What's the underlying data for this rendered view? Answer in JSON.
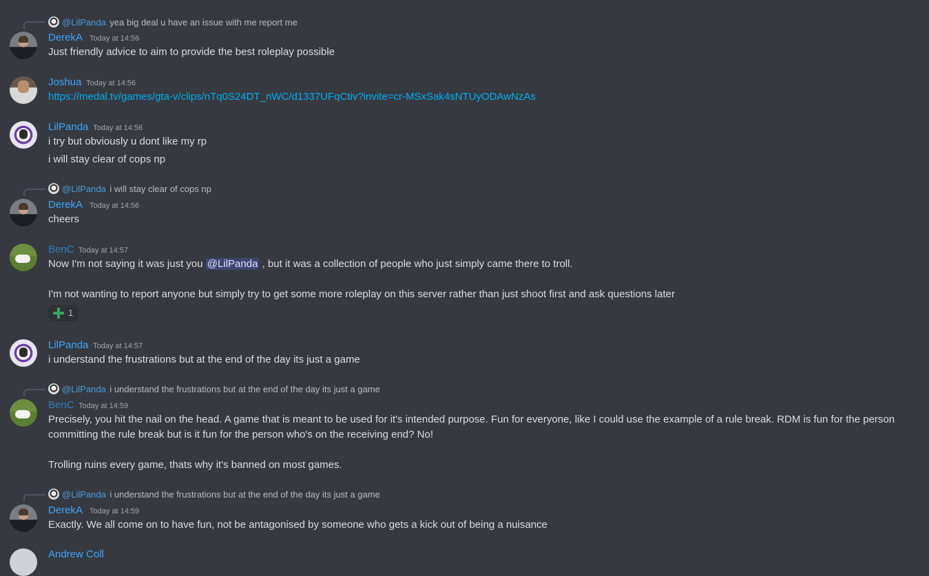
{
  "colors": {
    "background": "#36393f",
    "derek": "#3ea6ff",
    "joshua": "#3ea6ff",
    "lilpanda": "#3ea6ff",
    "benc": "#2f7fc1",
    "andy": "#3ea6ff",
    "link": "#00aff4",
    "reaction_icon": "#3ba55c"
  },
  "messages": [
    {
      "reply": {
        "name": "@LilPanda",
        "text": "yea big deal u have an issue with me report me"
      },
      "author": "DerekA",
      "time": "Today at 14:56",
      "lines": [
        "Just friendly advice to aim to provide the best roleplay possible"
      ]
    },
    {
      "author": "Joshua",
      "time": "Today at 14:56",
      "lines": [
        "https://medal.tv/games/gta-v/clips/nTq0S24DT_nWC/d1337UFqCtiv?invite=cr-MSxSak4sNTUyODAwNzAs"
      ]
    },
    {
      "author": "LilPanda",
      "time": "Today at 14:56",
      "lines": [
        "i try but obviously u dont like my rp",
        "i will stay clear of cops np"
      ]
    },
    {
      "reply": {
        "name": "@LilPanda",
        "text": "i will stay clear of cops np"
      },
      "author": "DerekA",
      "time": "Today at 14:56",
      "lines": [
        "cheers"
      ]
    },
    {
      "author": "BenC",
      "time": "Today at 14:57",
      "line1_before": "Now I'm not saying it was just you",
      "mention": "@LilPanda",
      "line1_after": ", but it was a collection of people who just simply came there to troll.",
      "line2": "I'm not wanting to report anyone but simply try to get some more roleplay on this server rather than just shoot first and ask questions later",
      "reaction": {
        "icon": "heavy-plus-icon",
        "count": "1"
      }
    },
    {
      "author": "LilPanda",
      "time": "Today at 14:57",
      "lines": [
        "i understand the frustrations but at the end of the day its just a game"
      ]
    },
    {
      "reply": {
        "name": "@LilPanda",
        "text": "i understand the frustrations but at the end of the day its just a game"
      },
      "author": "BenC",
      "time": "Today at 14:59",
      "lines": [
        "Precisely, you hit the nail on the head. A game that is meant to be used for it's intended purpose. Fun for everyone, like I could use the example of a rule break. RDM is fun for the person",
        "committing the rule break but is it fun for the person who's on the receiving end? No!",
        "Trolling ruins every game, thats why it's banned on most games."
      ]
    },
    {
      "reply": {
        "name": "@LilPanda",
        "text": "i understand the frustrations but at the end of the day its just a game"
      },
      "author": "DerekA",
      "time": "Today at 14:59",
      "lines": [
        "Exactly. We all come on to have fun, not be antagonised by someone who gets a kick out of being a nuisance"
      ]
    },
    {
      "author": "Andrew Coll"
    }
  ]
}
